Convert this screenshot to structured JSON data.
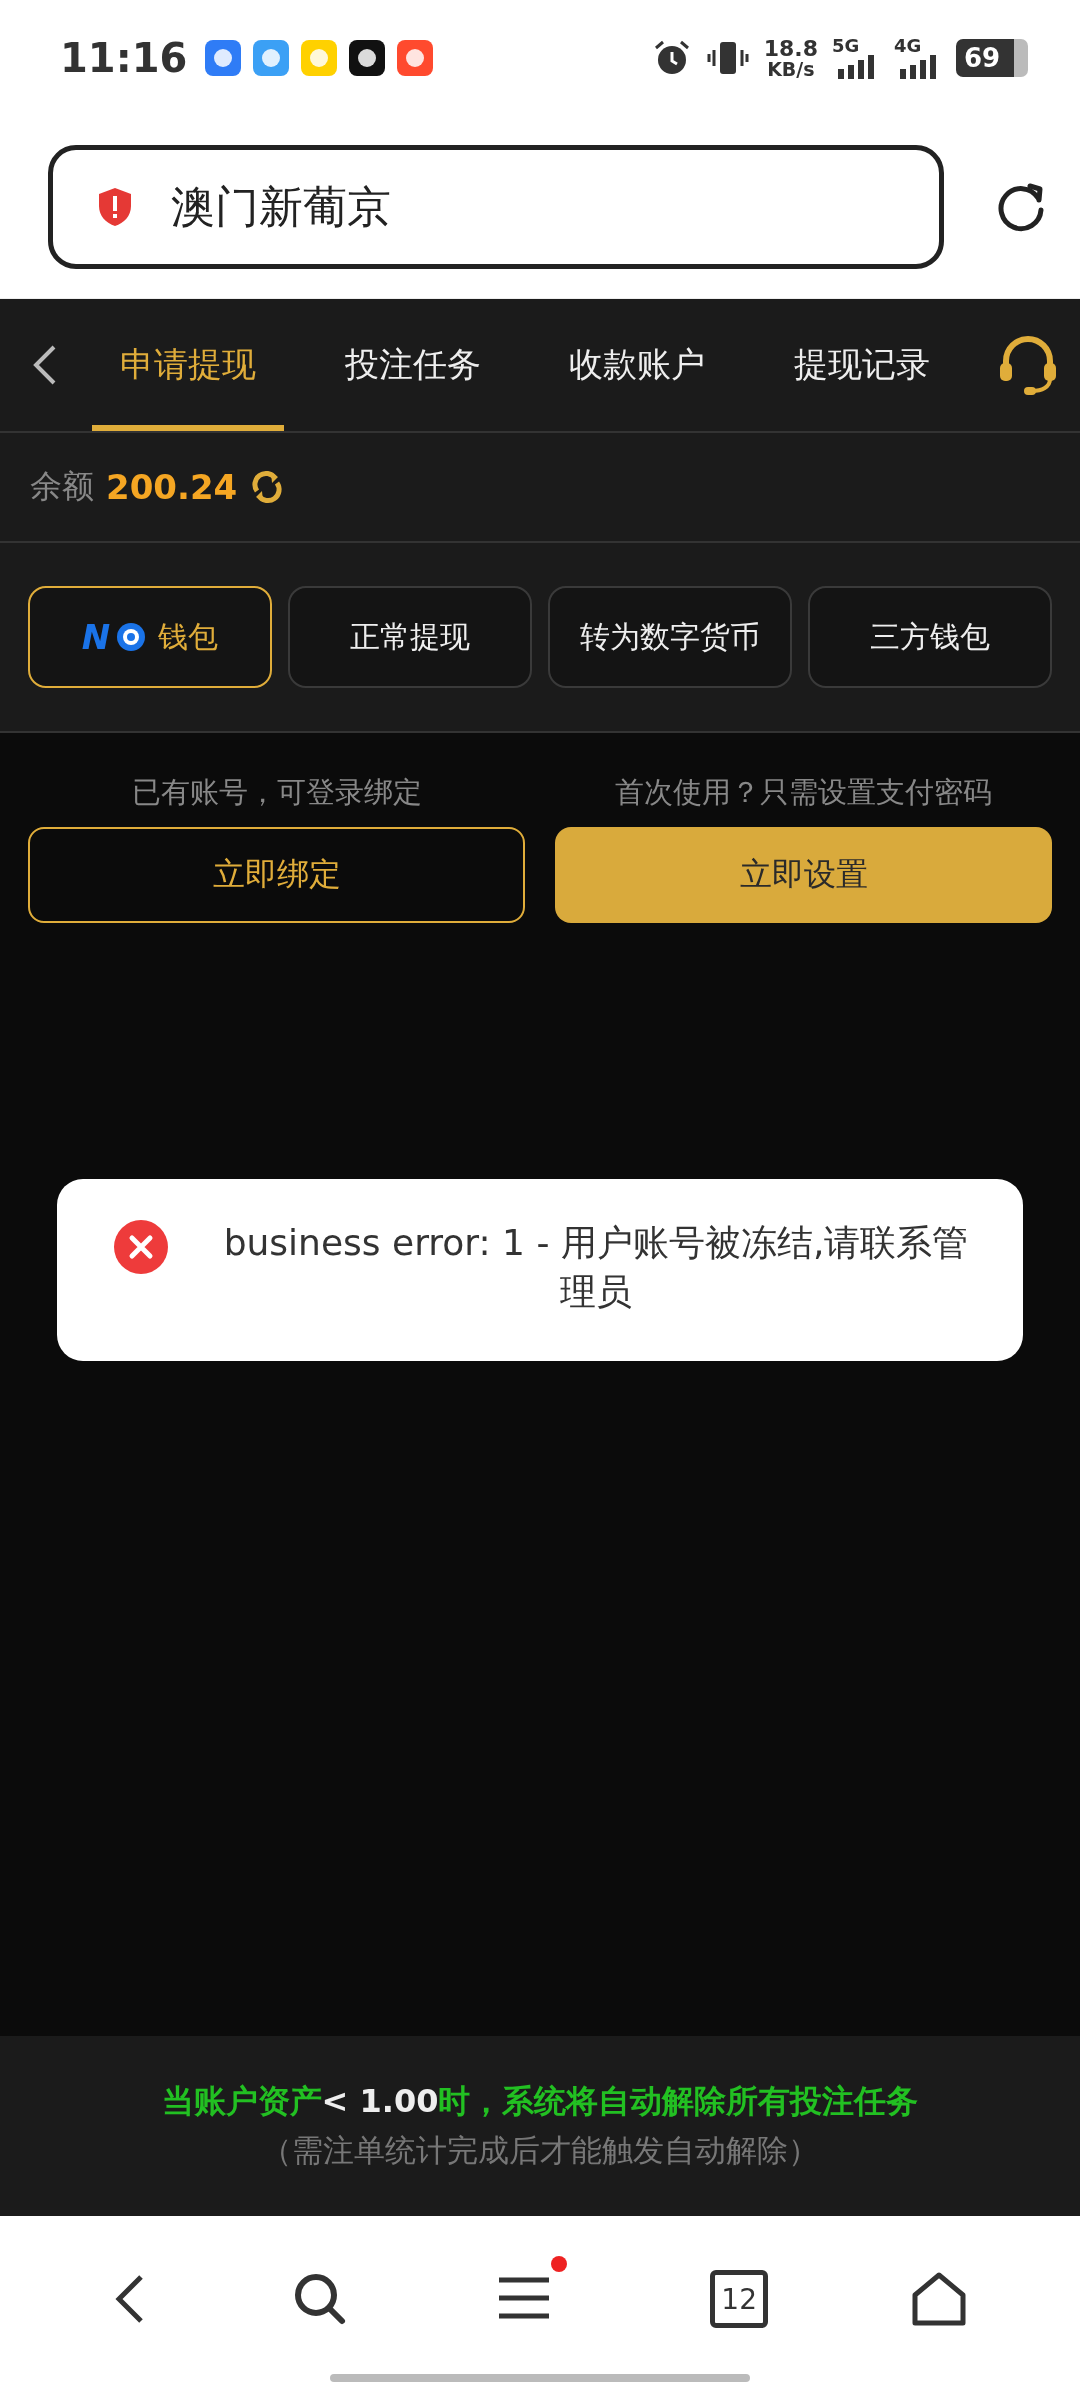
{
  "status_bar": {
    "time": "11:16",
    "apps": [
      {
        "color": "#2f7cf6"
      },
      {
        "color": "#3ba0f5"
      },
      {
        "color": "#ffd100"
      },
      {
        "color": "#111111"
      },
      {
        "color": "#ff4a2e"
      }
    ],
    "speed": "18.8",
    "speed_unit": "KB/s",
    "networks": [
      "5G",
      "4G"
    ],
    "battery": "69"
  },
  "address_bar": {
    "title": "澳门新葡京"
  },
  "nav_tabs": [
    {
      "label": "申请提现",
      "selected": true
    },
    {
      "label": "投注任务",
      "selected": false
    },
    {
      "label": "收款账户",
      "selected": false
    },
    {
      "label": "提现记录",
      "selected": false
    }
  ],
  "balance": {
    "label": "余额",
    "value": "200.24"
  },
  "wallet_options": [
    {
      "label": "钱包",
      "logo": "N",
      "selected": true
    },
    {
      "label": "正常提现",
      "selected": false
    },
    {
      "label": "转为数字货币",
      "selected": false
    },
    {
      "label": "三方钱包",
      "selected": false
    }
  ],
  "bind_options": [
    {
      "hint": "已有账号，可登录绑定",
      "button": "立即绑定",
      "kind": "outline"
    },
    {
      "hint": "首次使用？只需设置支付密码",
      "button": "立即设置",
      "kind": "filled"
    }
  ],
  "toast": {
    "message": "business error: 1 - 用户账号被冻结,请联系管理员"
  },
  "notice": {
    "parts": [
      {
        "text": "当账户资产",
        "kind": "plain"
      },
      {
        "text": "< 1.00",
        "kind": "value"
      },
      {
        "text": "时，系统将自动解除所有投注任务",
        "kind": "plain"
      }
    ],
    "note": "（需注单统计完成后才能触发自动解除）"
  },
  "browser_bar": {
    "tab_count": "12",
    "menu_dot": true
  }
}
